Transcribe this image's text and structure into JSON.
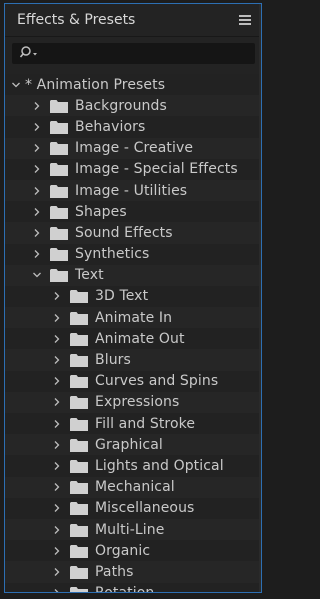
{
  "panel": {
    "title": "Effects & Presets",
    "menu_icon": "hamburger-menu-icon",
    "search_icon": "search-icon",
    "search_value": ""
  },
  "tree": {
    "root": {
      "label": "* Animation Presets",
      "expanded": true
    },
    "items": [
      {
        "label": "Backgrounds",
        "level": 1,
        "expanded": false
      },
      {
        "label": "Behaviors",
        "level": 1,
        "expanded": false
      },
      {
        "label": "Image - Creative",
        "level": 1,
        "expanded": false
      },
      {
        "label": "Image - Special Effects",
        "level": 1,
        "expanded": false
      },
      {
        "label": "Image - Utilities",
        "level": 1,
        "expanded": false
      },
      {
        "label": "Shapes",
        "level": 1,
        "expanded": false
      },
      {
        "label": "Sound Effects",
        "level": 1,
        "expanded": false
      },
      {
        "label": "Synthetics",
        "level": 1,
        "expanded": false
      },
      {
        "label": "Text",
        "level": 1,
        "expanded": true
      },
      {
        "label": "3D Text",
        "level": 2,
        "expanded": false
      },
      {
        "label": "Animate In",
        "level": 2,
        "expanded": false
      },
      {
        "label": "Animate Out",
        "level": 2,
        "expanded": false
      },
      {
        "label": "Blurs",
        "level": 2,
        "expanded": false
      },
      {
        "label": "Curves and Spins",
        "level": 2,
        "expanded": false
      },
      {
        "label": "Expressions",
        "level": 2,
        "expanded": false
      },
      {
        "label": "Fill and Stroke",
        "level": 2,
        "expanded": false
      },
      {
        "label": "Graphical",
        "level": 2,
        "expanded": false
      },
      {
        "label": "Lights and Optical",
        "level": 2,
        "expanded": false
      },
      {
        "label": "Mechanical",
        "level": 2,
        "expanded": false
      },
      {
        "label": "Miscellaneous",
        "level": 2,
        "expanded": false
      },
      {
        "label": "Multi-Line",
        "level": 2,
        "expanded": false
      },
      {
        "label": "Organic",
        "level": 2,
        "expanded": false
      },
      {
        "label": "Paths",
        "level": 2,
        "expanded": false
      },
      {
        "label": "Rotation",
        "level": 2,
        "expanded": false
      }
    ]
  },
  "colors": {
    "accent_border": "#2d6fb3",
    "folder": "#d0d0d0",
    "text": "#c9c9c9"
  }
}
